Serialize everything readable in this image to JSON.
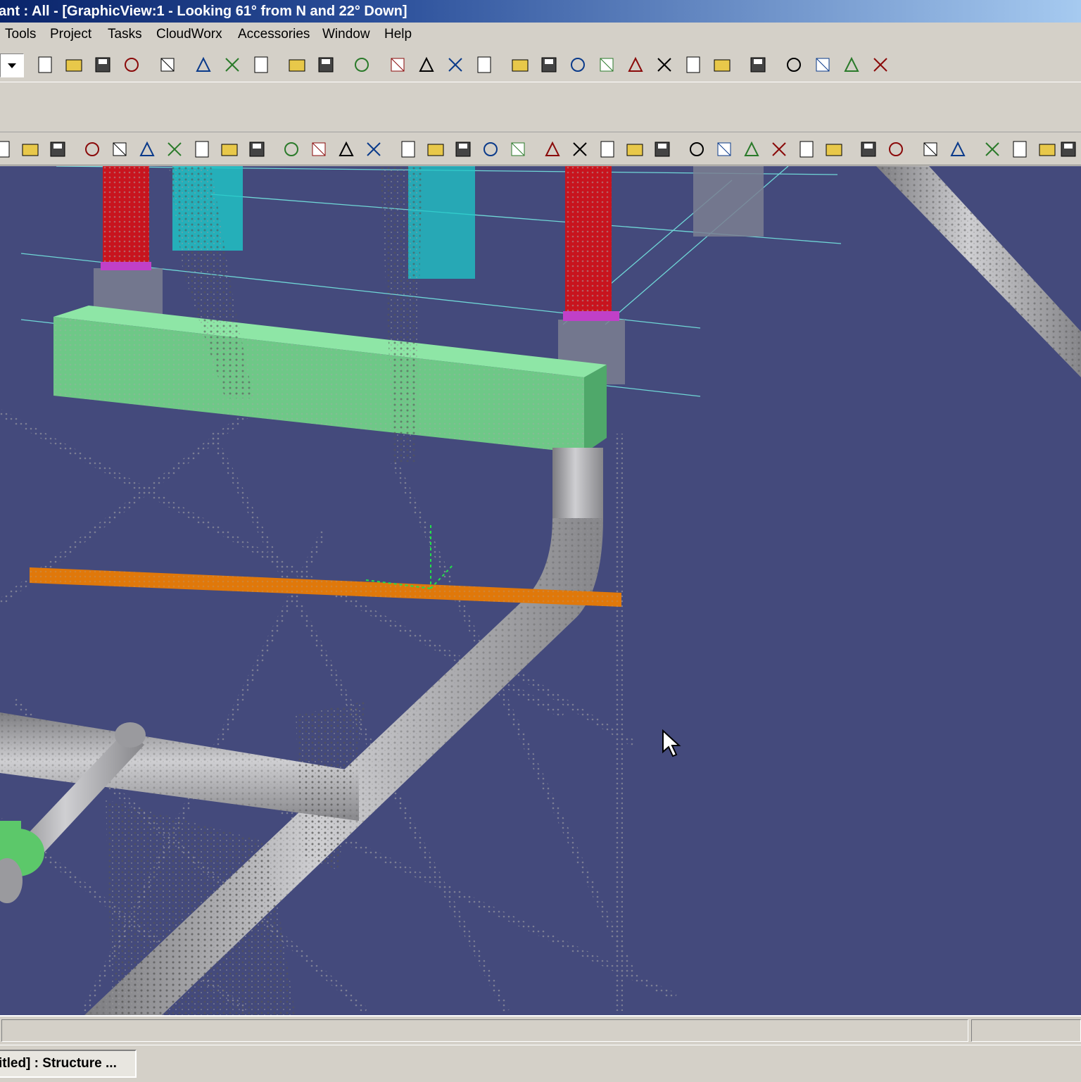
{
  "window": {
    "title": "ant : All - [GraphicView:1 - Looking 61° from N and 22° Down]"
  },
  "menubar": {
    "items": [
      {
        "label": "Tools"
      },
      {
        "label": "Project"
      },
      {
        "label": "Tasks"
      },
      {
        "label": "CloudWorx"
      },
      {
        "label": "Accessories"
      },
      {
        "label": "Window"
      },
      {
        "label": "Help"
      }
    ]
  },
  "toolbar_standard": {
    "buttons": [
      "view-dropdown",
      "new-file-icon",
      "open-folder-icon",
      "save-icon",
      "refresh-icon",
      "copy-icon",
      "paste-icon",
      "delete-icon",
      "move-icon",
      "rotate-icon",
      "undo-icon",
      "select-icon",
      "edit-icon",
      "measure-icon",
      "tape-icon",
      "view-iso-icon",
      "view-front-icon",
      "view-top-icon",
      "view-side-icon",
      "view-persp-icon",
      "clip-icon",
      "display-icon",
      "layer-icon",
      "dropdown-icon",
      "zoom-icon",
      "zoom-window-icon",
      "zoom-extents-icon",
      "pan-icon",
      "help-icon"
    ]
  },
  "toolbar_cloudworx": {
    "buttons": [
      "cloud-a-icon",
      "cloud-b-icon",
      "cloud-c-icon",
      "point-add-1-icon",
      "point-add-2-icon",
      "point-add-3-icon",
      "point-set-1-icon",
      "point-set-2-icon",
      "point-fit-icon",
      "point-delete-icon",
      "region-1-icon",
      "region-2-icon",
      "region-3-icon",
      "region-4-icon",
      "cut-1-icon",
      "cut-2-icon",
      "cut-3-icon",
      "cut-4-icon",
      "cut-5-icon",
      "slice-1-icon",
      "slice-2-icon",
      "slice-3-icon",
      "slice-4-icon",
      "slice-5-icon",
      "fence-1-icon",
      "fence-2-icon",
      "fence-3-icon",
      "fence-4-icon",
      "fence-5-icon",
      "fence-6-icon",
      "color-map-icon",
      "visibility-icon",
      "limit-1-icon",
      "limit-2-icon",
      "axis-x-icon",
      "axis-1-icon",
      "axis-2-icon",
      "axis-3-icon"
    ]
  },
  "viewport": {
    "background": "#444a7c",
    "colors": {
      "steel_red": "#c8141e",
      "steel_cyan": "#1ec8c8",
      "beam_green": "#6ec887",
      "beam_orange": "#e0780a",
      "pipe_gray": "#a0a0a4",
      "valve_green": "#5cc86a"
    }
  },
  "taskbar": {
    "active_task": "itled] : Structure ..."
  }
}
